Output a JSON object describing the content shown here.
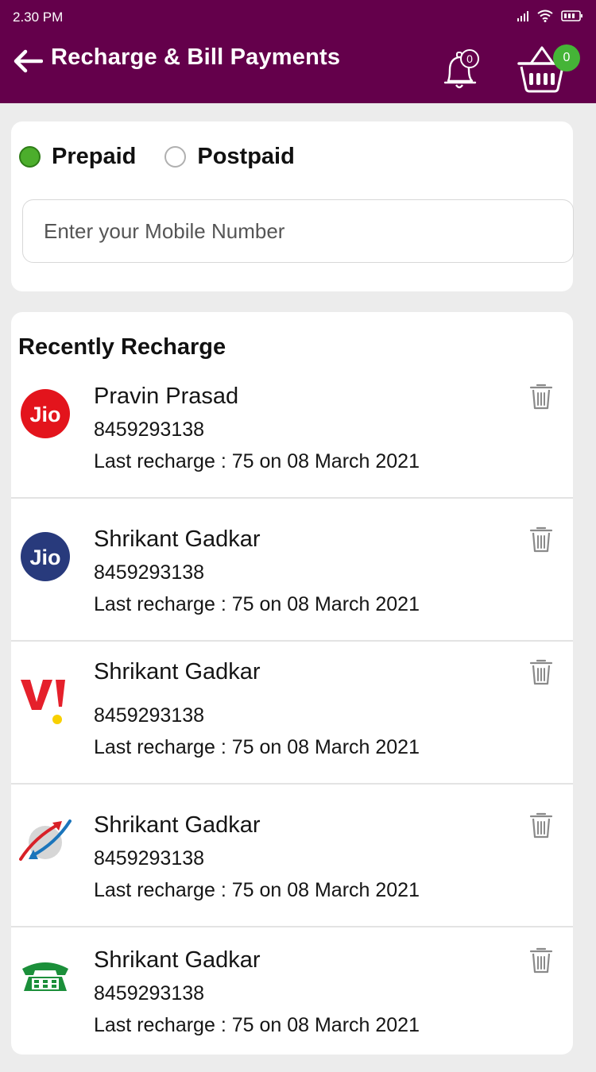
{
  "status_bar": {
    "time": "2.30 PM"
  },
  "header": {
    "title": "Recharge & Bill Payments",
    "notification_count": "0",
    "cart_count": "0"
  },
  "plan_type": {
    "options": [
      {
        "label": "Prepaid",
        "selected": true
      },
      {
        "label": "Postpaid",
        "selected": false
      }
    ]
  },
  "mobile_input": {
    "placeholder": "Enter your Mobile Number",
    "value": ""
  },
  "recent": {
    "title": "Recently Recharge",
    "items": [
      {
        "operator_icon": "jio-logo-red",
        "name": "Pravin Prasad",
        "number": "8459293138",
        "last_recharge": "Last recharge : 75 on 08 March 2021"
      },
      {
        "operator_icon": "jio-logo-blue",
        "name": "Shrikant Gadkar",
        "number": "8459293138",
        "last_recharge": "Last recharge : 75 on 08 March 2021"
      },
      {
        "operator_icon": "vi-logo",
        "name": "Shrikant Gadkar",
        "number": "8459293138",
        "last_recharge": "Last recharge : 75 on 08 March 2021"
      },
      {
        "operator_icon": "bsnl-logo",
        "name": "Shrikant Gadkar",
        "number": "8459293138",
        "last_recharge": "Last recharge : 75 on 08 March 2021"
      },
      {
        "operator_icon": "mtnl-logo",
        "name": "Shrikant Gadkar",
        "number": "8459293138",
        "last_recharge": "Last recharge : 75 on 08 March 2021"
      }
    ]
  },
  "colors": {
    "header_bg": "#64004b",
    "radio_selected": "#4cae2c",
    "cart_badge": "#45b437",
    "jio_red": "#e3141c",
    "jio_blue": "#283a7c",
    "vi_red": "#e5202b",
    "vi_yellow": "#f8d000",
    "mtnl_green": "#1b8f3a"
  }
}
